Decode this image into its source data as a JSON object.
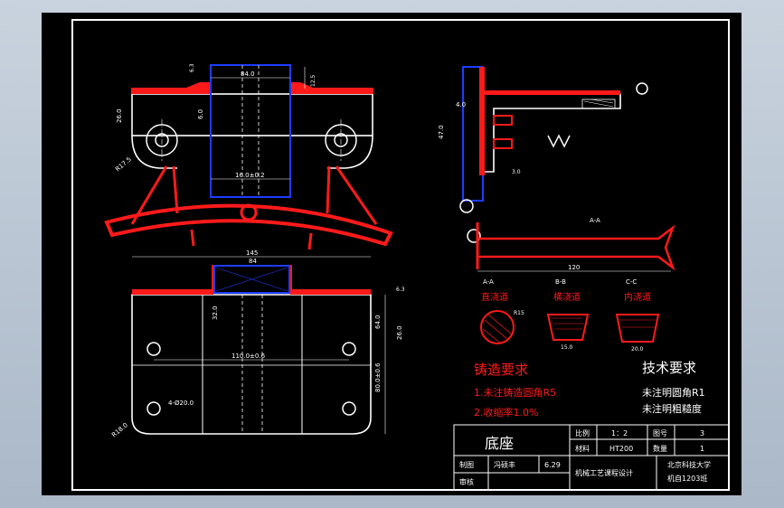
{
  "title_block": {
    "part_name": "底座",
    "scale_label": "比例",
    "scale_value": "1：2",
    "drawing_no_label": "图号",
    "drawing_no_value": "3",
    "material_label": "材料",
    "material_value": "HT200",
    "quantity_label": "数量",
    "quantity_value": "1",
    "drawn_label": "制图",
    "drawn_name": "冯硕丰",
    "drawn_date": "6.29",
    "checked_label": "审核",
    "course": "机械工艺课程设计",
    "school": "北京科技大学",
    "class_name": "机自1203班"
  },
  "notes": {
    "casting_title": "铸造要求",
    "casting_1": "1.未注铸造圆角R5",
    "casting_2": "2.收缩率1.0%",
    "tech_title": "技术要求",
    "tech_1": "未注明圆角R1",
    "tech_2": "未注明粗糙度"
  },
  "sections": {
    "a_label": "A-A",
    "b_label": "B-B",
    "c_label": "C-C",
    "a_name": "直浇道",
    "b_name": "横浇道",
    "c_name": "内浇道",
    "a_dim": "R15",
    "b_dim": "15.0",
    "c_dim": "20.0"
  },
  "dimensions": {
    "front_top": "84.0",
    "front_mid": "16.0±0.2",
    "front_left_h": "26.0",
    "front_inner": "6.0",
    "front_radius": "R17.5",
    "plan_width": "145",
    "plan_inner": "84",
    "plan_hole_span": "110.0±0.6",
    "plan_h1": "32.0",
    "plan_h2": "80.0±0.6",
    "plan_h3": "64.0",
    "plan_holes": "4-Ø20.0",
    "plan_corner": "R18.0",
    "side_h1": "47.0",
    "side_h2": "4.0",
    "side_bottom": "120",
    "side_small": "3.0",
    "rough_1": "6.3",
    "rough_2": "12.5"
  },
  "colors": {
    "outline": "#ffffff",
    "casting_red": "#ff1a1a",
    "core_blue": "#1e3cff",
    "dim_green": "#00ff00"
  }
}
